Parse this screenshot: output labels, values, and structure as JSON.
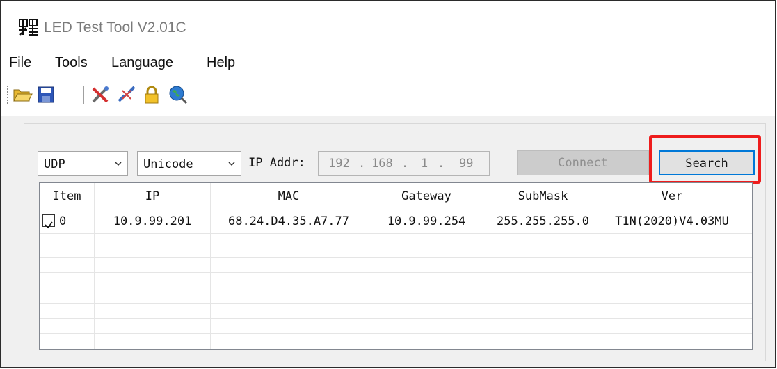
{
  "window": {
    "title": "LED Test Tool V2.01C"
  },
  "menu": [
    "File",
    "Tools",
    "Language",
    "Help"
  ],
  "toolbar": {
    "icons": [
      "open-folder-icon",
      "save-icon",
      "tools-icon",
      "disconnect-icon",
      "lock-icon",
      "globe-search-icon"
    ]
  },
  "controls": {
    "protocol": "UDP",
    "encoding": "Unicode",
    "ip_label": "IP Addr:",
    "ip": [
      "192",
      "168",
      "1",
      "99"
    ],
    "connect_label": "Connect",
    "search_label": "Search"
  },
  "table": {
    "columns": [
      "Item",
      "IP",
      "MAC",
      "Gateway",
      "SubMask",
      "Ver"
    ],
    "rows": [
      {
        "checked": true,
        "item": "0",
        "ip": "10.9.99.201",
        "mac": "68.24.D4.35.A7.77",
        "gateway": "10.9.99.254",
        "submask": "255.255.255.0",
        "ver": "T1N(2020)V4.03MU"
      }
    ]
  },
  "colors": {
    "highlight": "#ee1c1c",
    "focus": "#0078d7"
  }
}
